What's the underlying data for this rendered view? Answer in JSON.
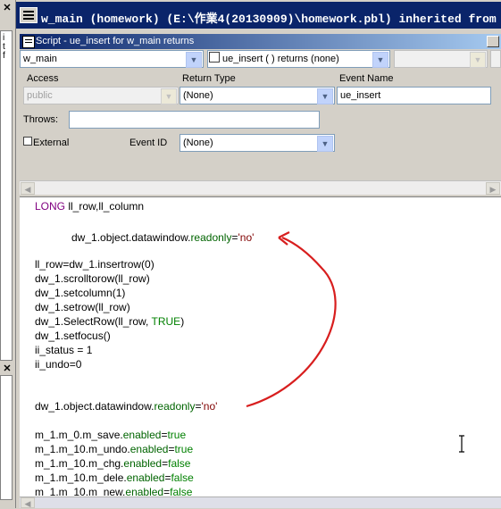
{
  "main_window": {
    "title": "w_main (homework) (E:\\作業4(20130909)\\homework.pbl) inherited from"
  },
  "script_window": {
    "title": "Script - ue_insert for w_main returns",
    "object_combo": "w_main",
    "event_combo": "ue_insert ( ) returns (none)",
    "access_label": "Access",
    "access_value": "public",
    "return_type_label": "Return Type",
    "return_type_value": "(None)",
    "event_name_label": "Event Name",
    "event_name_value": "ue_insert",
    "throws_label": "Throws:",
    "throws_value": "",
    "external_label": "External",
    "event_id_label": "Event ID",
    "event_id_value": "(None)"
  },
  "left_panel": {
    "glyphs": [
      "i",
      "t",
      "f"
    ]
  },
  "code": {
    "line1_kw": "LONG",
    "line1_rest": " ll_row,ll_column",
    "line2_pre": "dw_1.object.datawindow.",
    "line2_prop": "readonly",
    "line2_eq": "=",
    "line2_str": "'no'",
    "lines_mid": [
      "ll_row=dw_1.insertrow(0)",
      "dw_1.scrolltorow(ll_row)",
      "dw_1.setcolumn(1)",
      "dw_1.setrow(ll_row)"
    ],
    "select_pre": "dw_1.SelectRow(ll_row, ",
    "select_true": "TRUE",
    "select_post": ")",
    "setfocus": "dw_1.setfocus()",
    "status": "ii_status = 1",
    "undo": "ii_undo=0",
    "line3_pre": "dw_1.object.datawindow.",
    "line3_prop": "readonly",
    "line3_eq": "=",
    "line3_str": "'no'",
    "menu_lines": [
      {
        "pre": "m_1.m_0.m_save.",
        "prop": "enabled",
        "eq": "=",
        "val": "true"
      },
      {
        "pre": "m_1.m_10.m_undo.",
        "prop": "enabled",
        "eq": "=",
        "val": "true"
      },
      {
        "pre": "m_1.m_10.m_chg.",
        "prop": "enabled",
        "eq": "=",
        "val": "false"
      },
      {
        "pre": "m_1.m_10.m_dele.",
        "prop": "enabled",
        "eq": "=",
        "val": "false"
      },
      {
        "pre": "m_1.m_10.m_new.",
        "prop": "enabled",
        "eq": "=",
        "val": "false"
      }
    ]
  },
  "annotation": {
    "arrow_color": "#d81e1e"
  }
}
